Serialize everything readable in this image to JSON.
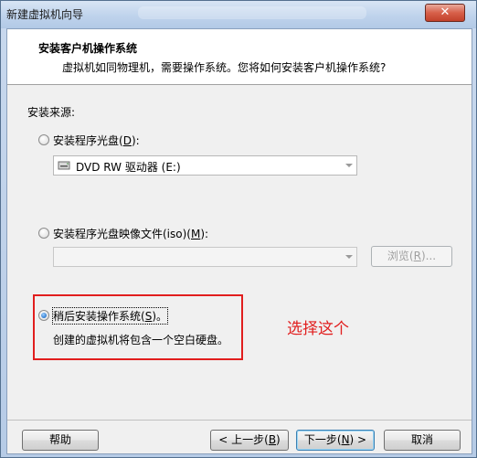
{
  "window": {
    "title": "新建虚拟机向导",
    "close_glyph": "✕"
  },
  "header": {
    "title": "安装客户机操作系统",
    "subtitle": "虚拟机如同物理机，需要操作系统。您将如何安装客户机操作系统?"
  },
  "install_source": {
    "label": "安装来源:",
    "options": [
      {
        "label_prefix": "安装程序光盘(",
        "mnemonic": "D",
        "label_suffix": "):",
        "selected": false
      },
      {
        "label_prefix": "安装程序光盘映像文件(iso)(",
        "mnemonic": "M",
        "label_suffix": "):",
        "selected": false
      },
      {
        "label_prefix": "稍后安装操作系统(",
        "mnemonic": "S",
        "label_suffix": ")。",
        "selected": true,
        "description": "创建的虚拟机将包含一个空白硬盘。"
      }
    ],
    "disc_drive": {
      "value": "DVD RW 驱动器 (E:)",
      "icon": "dvd-drive-icon"
    },
    "iso_path": {
      "value": ""
    },
    "browse_button": {
      "prefix": "浏览(",
      "mnemonic": "R",
      "suffix": ")..."
    }
  },
  "annotation": {
    "text": "选择这个",
    "color": "#e11e1e"
  },
  "footer": {
    "help": "帮助",
    "back": {
      "prefix": "< 上一步(",
      "mnemonic": "B",
      "suffix": ")"
    },
    "next": {
      "prefix": "下一步(",
      "mnemonic": "N",
      "suffix": ") >"
    },
    "cancel": "取消"
  }
}
